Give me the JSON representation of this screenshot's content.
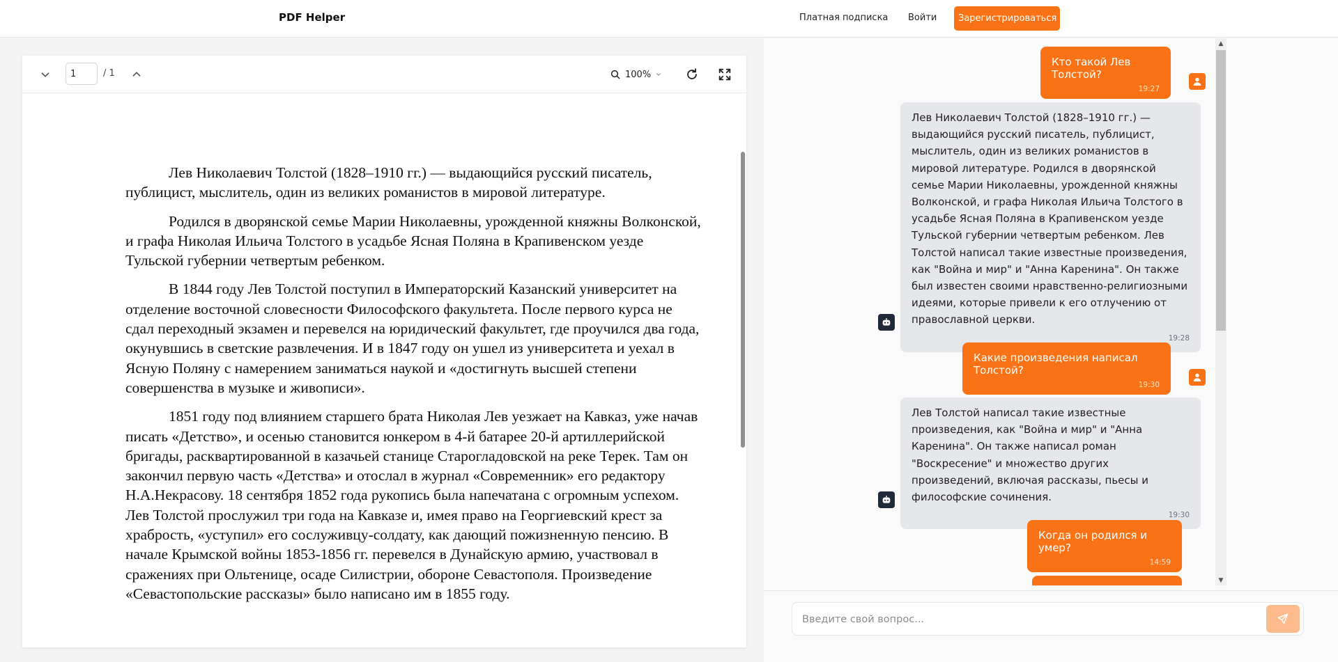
{
  "header": {
    "brand": "PDF Helper",
    "subscription_link": "Платная подписка",
    "login_link": "Войти",
    "register_button": "Зарегистрироваться"
  },
  "pdf_viewer": {
    "page_input": "1",
    "page_total": "/ 1",
    "zoom": "100%",
    "paragraphs": [
      "Лев Николаевич Толстой (1828–1910 гг.) — выдающийся русский писатель, публицист, мыслитель, один из великих романистов в мировой литературе.",
      "Родился в дворянской семье Марии Николаевны, урожденной княжны Волконской, и графа Николая Ильича Толстого в усадьбе Ясная Поляна в Крапивенском уезде Тульской губернии четвертым ребенком.",
      "В 1844 году Лев Толстой поступил в Императорский Казанский университет на отделение восточной словесности Философского факультета. После первого курса не сдал переходный экзамен и перевелся на юридический факультет, где проучился два года, окунувшись в светские развлечения. И в 1847 году он ушел из университета и уехал в Ясную Поляну с намерением заниматься наукой и «достигнуть высшей степени совершенства в музыке и живописи».",
      "1851 году под влиянием старшего брата Николая Лев уезжает на Кавказ, уже начав писать «Детство», и осенью становится юнкером в 4-й батарее 20-й артиллерийской бригады, расквартированной в казачьей станице Старогладовской на реке Терек. Там он закончил первую часть «Детства» и отослал в журнал «Современник» его редактору Н.А.Некрасову. 18 сентября 1852 года рукопись была напечатана с огромным успехом. Лев Толстой прослужил три года на Кавказе и, имея право на Георгиевский крест за храбрость, «уступил» его сослуживцу-солдату, как дающий пожизненную пенсию. В начале Крымской войны 1853-1856 гг. перевелся в Дунайскую армию, участвовал в сражениях при Ольтенице, осаде Силистрии, обороне Севастополя. Произведение «Севастопольские рассказы» было написано им в 1855 году."
    ]
  },
  "chat": {
    "messages": [
      {
        "role": "user",
        "text": "Кто такой Лев Толстой?",
        "time": "19:27"
      },
      {
        "role": "bot",
        "text": "Лев Николаевич Толстой (1828–1910 гг.) — выдающийся русский писатель, публицист, мыслитель, один из великих романистов в мировой литературе. Родился в дворянской семье Марии Николаевны, урожденной княжны Волконской, и графа Николая Ильича Толстого в усадьбе Ясная Поляна в Крапивенском уезде Тульской губернии четвертым ребенком. Лев Толстой написал такие известные произведения, как \"Война и мир\" и \"Анна Каренина\". Он также был известен своими нравственно-религиозными идеями, которые привели к его отлучению от православной церкви.",
        "time": "19:28"
      },
      {
        "role": "user",
        "text": "Какие произведения написал Толстой?",
        "time": "19:30"
      },
      {
        "role": "bot",
        "text": "Лев Толстой написал такие известные произведения, как \"Война и мир\" и \"Анна Каренина\". Он также написал роман \"Воскресение\" и множество других произведений, включая рассказы, пьесы и философские сочинения.",
        "time": "19:30"
      },
      {
        "role": "user",
        "text": "Когда он родился и умер?",
        "time": "14:59"
      }
    ],
    "input_placeholder": "Введите свой вопрос..."
  },
  "colors": {
    "accent": "#f97316",
    "bot_bubble": "#e5e7eb",
    "send_button_disabled": "#fdba8c"
  }
}
